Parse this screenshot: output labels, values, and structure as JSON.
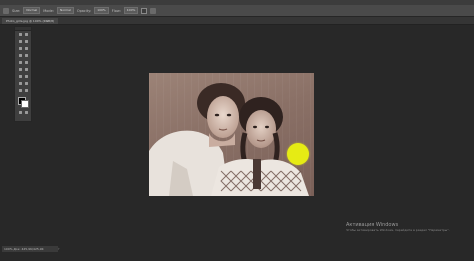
{
  "options_bar": {
    "items": [
      {
        "type": "icon",
        "name": "brush-preset-icon"
      },
      {
        "type": "label",
        "text": "Size:"
      },
      {
        "type": "box",
        "text": "Normal"
      },
      {
        "type": "label",
        "text": "Mode:"
      },
      {
        "type": "box",
        "text": "Normal"
      },
      {
        "type": "label",
        "text": "Opacity:"
      },
      {
        "type": "box",
        "text": "100%"
      },
      {
        "type": "label",
        "text": "Flow:"
      },
      {
        "type": "box",
        "text": "100%"
      },
      {
        "type": "check",
        "name": "sample-all-layers-checkbox"
      },
      {
        "type": "icon",
        "name": "pressure-icon"
      }
    ]
  },
  "document": {
    "tab_title": "Photo_girls.jpg @ 100% (RGB/8)",
    "close_label": "×"
  },
  "canvas": {
    "cursor_color": "#e6eb14"
  },
  "watermark": {
    "title": "Активация Windows",
    "subtitle": "Чтобы активировать Windows, перейдите в раздел \"Параметры\"."
  },
  "status_bar": {
    "zoom_text": "100%  Док: 425,9K/425,9K",
    "arrow": "›"
  }
}
